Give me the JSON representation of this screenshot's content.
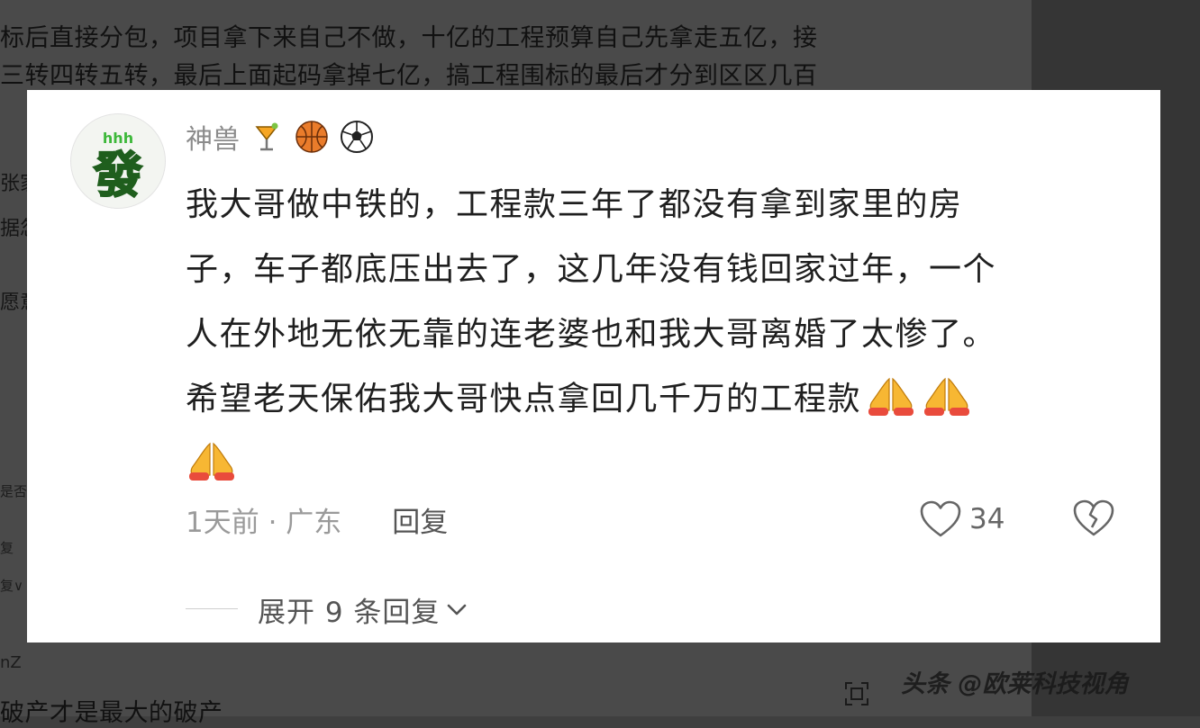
{
  "background": {
    "line1": "标后直接分包，项目拿下来自己不做，十亿的工程预算自己先拿走五亿，接",
    "line2": "三转四转五转，最后上面起码拿掉七亿，搞工程围标的最后才分到区区几百",
    "side1": "张家",
    "side2": "据忽",
    "side3": "愿意",
    "side4": "是否",
    "side5": "复",
    "side6": "复∨",
    "user_z": "nZ",
    "bottom_line": "破产才是最大的破产"
  },
  "comment": {
    "username": "神兽",
    "badges": [
      "cocktail-icon",
      "basketball-icon",
      "soccer-ball-icon"
    ],
    "avatar_text": "發",
    "avatar_caption": "hhh",
    "line1": "我大哥做中铁的，工程款三年了都没有拿到家里的房",
    "line2": "子，车子都底压出去了，这几年没有钱回家过年，一个",
    "line3": "人在外地无依无靠的连老婆也和我大哥离婚了太惨了。",
    "line4": "希望老天保佑我大哥快点拿回几千万的工程款",
    "time_location": "1天前 · 广东",
    "reply_label": "回复",
    "like_count": "34",
    "expand_label": "展开 9 条回复"
  },
  "watermark": "头条 @欧莱科技视角",
  "colors": {
    "card_bg": "#ffffff",
    "avatar_green": "#3db83a",
    "emoji_orange": "#f6a623",
    "meta_gray": "#9a9a9a"
  }
}
